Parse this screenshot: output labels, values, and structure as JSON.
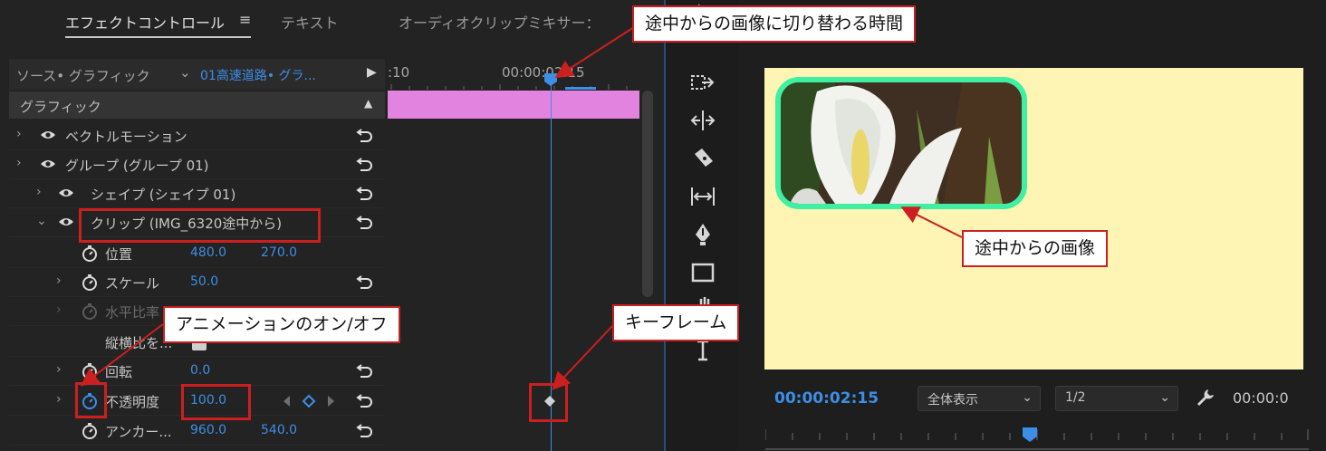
{
  "tabs": [
    {
      "label": "エフェクトコントロール"
    },
    {
      "label": "≡"
    },
    {
      "label": "テキスト"
    },
    {
      "label": "オーディオクリップミキサー："
    }
  ],
  "source": {
    "label": "ソース• グラフィック",
    "chevron": "⌄",
    "clip": "01高速道路• グラ..."
  },
  "section": {
    "title": "グラフィック"
  },
  "layers": [
    {
      "label": "ベクトルモーション"
    },
    {
      "label": "グループ (グループ 01)"
    },
    {
      "label": "シェイプ (シェイプ 01)"
    },
    {
      "label": "クリップ (IMG_6320途中から)"
    }
  ],
  "properties": {
    "position": {
      "label": "位置",
      "x": "480.0",
      "y": "270.0"
    },
    "scale": {
      "label": "スケール",
      "value": "50.0"
    },
    "scale_width": {
      "label": "水平比率"
    },
    "uniform": {
      "label": "縦横比を..."
    },
    "rotation": {
      "label": "回転",
      "value": "0.0"
    },
    "opacity": {
      "label": "不透明度",
      "value": "100.0"
    },
    "anchor": {
      "label": "アンカー...",
      "x": "960.0",
      "y": "540.0"
    }
  },
  "timeline": {
    "ruler_start": ":10",
    "ruler_tc": "00:00:02:15"
  },
  "monitor": {
    "timecode": "00:00:02:15",
    "fit_label": "全体表示",
    "resolution": "1/2",
    "timecode_right": "00:00:0"
  },
  "callouts": {
    "switch_time": "途中からの画像に切り替わる時間",
    "mid_image": "途中からの画像",
    "anim_toggle": "アニメーションのオン/オフ",
    "keyframe": "キーフレーム"
  },
  "colors": {
    "accent": "#3d8ee6",
    "clip_bar": "#e283e0",
    "canvas": "#fef5b4",
    "frame": "#3ff0a3",
    "callout_border": "#cc1f1f"
  }
}
